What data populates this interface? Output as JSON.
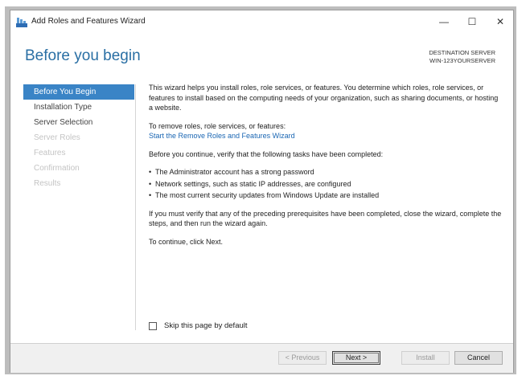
{
  "window": {
    "title": "Add Roles and Features Wizard",
    "minimize_glyph": "—",
    "maximize_glyph": "☐",
    "close_glyph": "✕"
  },
  "header": {
    "page_title": "Before you begin",
    "destination_label": "DESTINATION SERVER",
    "destination_server": "WIN-123YOURSERVER"
  },
  "nav": {
    "items": [
      {
        "label": "Before You Begin",
        "state": "active"
      },
      {
        "label": "Installation Type",
        "state": "enabled"
      },
      {
        "label": "Server Selection",
        "state": "enabled"
      },
      {
        "label": "Server Roles",
        "state": "disabled"
      },
      {
        "label": "Features",
        "state": "disabled"
      },
      {
        "label": "Confirmation",
        "state": "disabled"
      },
      {
        "label": "Results",
        "state": "disabled"
      }
    ]
  },
  "content": {
    "intro": "This wizard helps you install roles, role services, or features. You determine which roles, role services, or features to install based on the computing needs of your organization, such as sharing documents, or hosting a website.",
    "remove_intro": "To remove roles, role services, or features:",
    "remove_link": "Start the Remove Roles and Features Wizard",
    "verify_intro": "Before you continue, verify that the following tasks have been completed:",
    "tasks": [
      "The Administrator account has a strong password",
      "Network settings, such as static IP addresses, are configured",
      "The most current security updates from Windows Update are installed"
    ],
    "verify_note": "If you must verify that any of the preceding prerequisites have been completed, close the wizard, complete the steps, and then run the wizard again.",
    "continue_note": "To continue, click Next."
  },
  "skip": {
    "label": "Skip this page by default",
    "checked": false
  },
  "footer": {
    "previous_label": "< Previous",
    "next_label": "Next >",
    "install_label": "Install",
    "cancel_label": "Cancel"
  },
  "colors": {
    "title_blue": "#2a6fa4",
    "nav_active": "#3a84c6",
    "link_blue": "#1a66b3"
  }
}
